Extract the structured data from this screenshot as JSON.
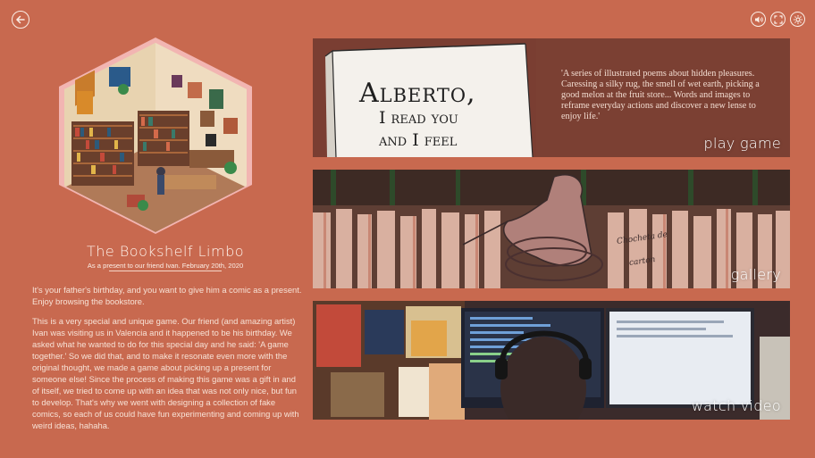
{
  "app": {
    "title": "The Bookshelf Limbo",
    "subtitle": "As a present to our friend Ivan. February 20th, 2020"
  },
  "description": {
    "intro": "It's your father's birthday, and you want to give him a comic as a present. Enjoy browsing the bookstore.",
    "body": "This is a very special and unique game. Our friend (and amazing artist) Ivan was visiting us in Valencia and it happened to be his birthday. We asked what he wanted to do for this special day and he said: 'A game together.' So we did that, and to make it resonate even more with the original thought, we made a game about picking up a present for someone else! Since the process of making this game was a gift in and of itself, we tried to come up with an idea that was not only nice, but fun to develop. That's why we went with designing a collection of fake comics, so each of us could have fun experimenting and coming up with weird ideas, hahaha."
  },
  "panels": {
    "play": {
      "label": "play game",
      "book_title_line1": "Alberto,",
      "book_title_line2": "I read you",
      "book_title_line3": "and I feel",
      "quote": "'A series of illustrated poems about hidden pleasures. Caressing a silky rug, the smell of wet earth, picking a good melon at the fruit store... Words and images to reframe everyday actions and discover a new lense to enjoy life.'"
    },
    "gallery": {
      "label": "gallery",
      "scribble_line1": "Chocheta de",
      "scribble_line2": "carton"
    },
    "video": {
      "label": "watch video"
    }
  },
  "icons": {
    "back": "back-arrow-icon",
    "sound": "speaker-icon",
    "fullscreen": "fullscreen-icon",
    "settings": "gear-icon"
  },
  "colors": {
    "background": "#c8694f",
    "text": "#fbeee6",
    "hex_border": "#f2b5b2"
  }
}
